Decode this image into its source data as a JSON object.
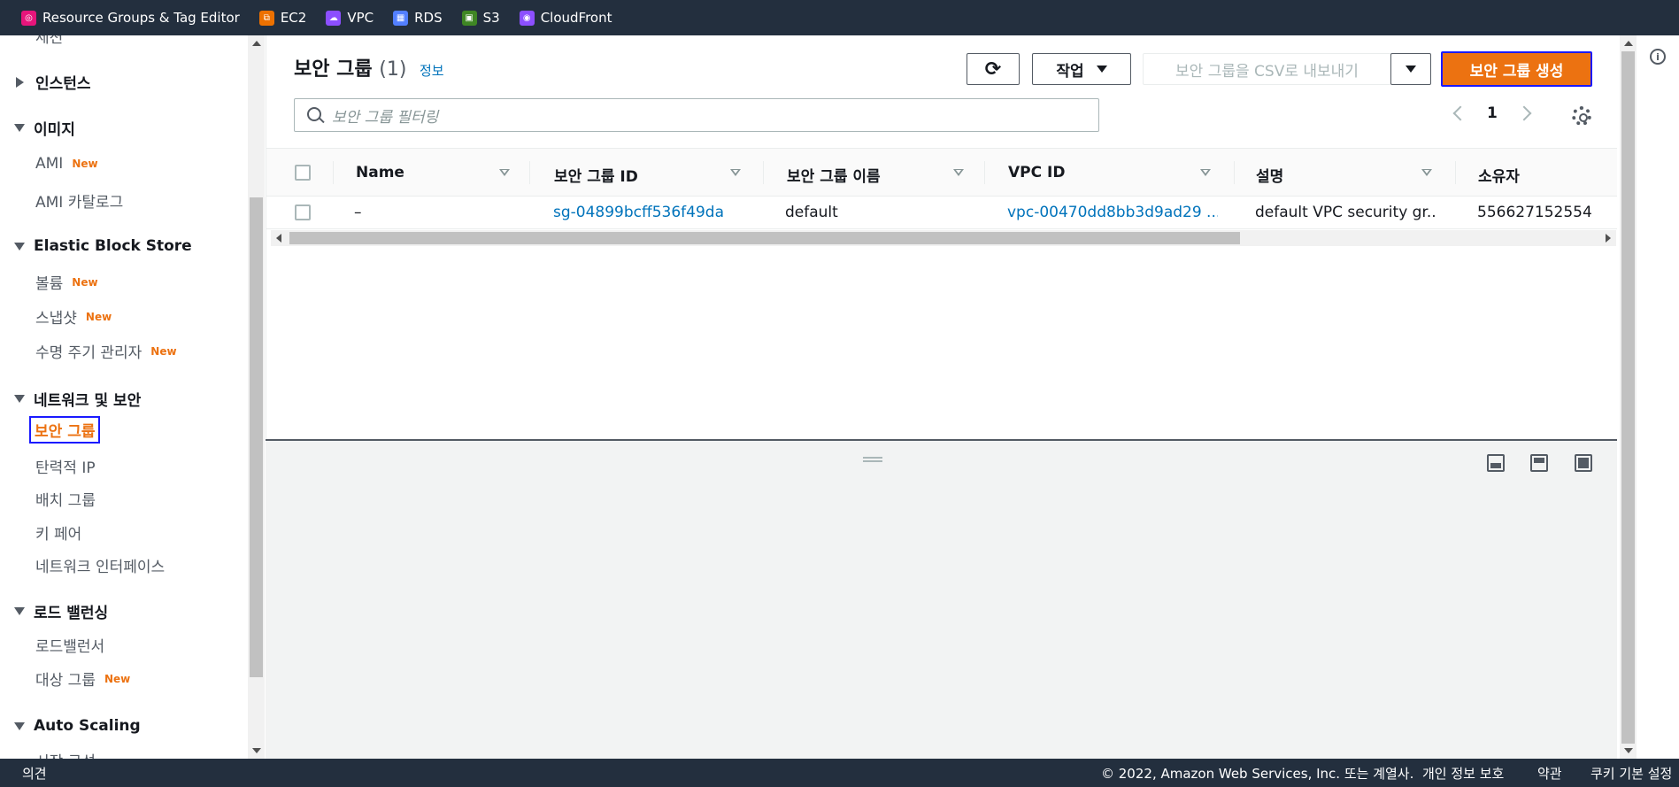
{
  "topbar": {
    "favorites": [
      {
        "label": "Resource Groups & Tag Editor",
        "icon": "resource-groups-icon",
        "color": "#e7157b"
      },
      {
        "label": "EC2",
        "icon": "ec2-icon",
        "color": "#ed7100"
      },
      {
        "label": "VPC",
        "icon": "vpc-icon",
        "color": "#8c4fff"
      },
      {
        "label": "RDS",
        "icon": "rds-icon",
        "color": "#527fff"
      },
      {
        "label": "S3",
        "icon": "s3-icon",
        "color": "#3f8624"
      },
      {
        "label": "CloudFront",
        "icon": "cloudfront-icon",
        "color": "#8c4fff"
      }
    ]
  },
  "sidebar": {
    "partial_top": "세션",
    "partial_bottom": "시작 구성",
    "instances": "인스턴스",
    "images": {
      "title": "이미지",
      "ami": "AMI",
      "ami_catalog": "AMI 카탈로그"
    },
    "ebs": {
      "title": "Elastic Block Store",
      "volumes": "볼륨",
      "snapshots": "스냅샷",
      "lifecycle": "수명 주기 관리자"
    },
    "network": {
      "title": "네트워크 및 보안",
      "security_groups": "보안 그룹",
      "elastic_ip": "탄력적 IP",
      "placement_groups": "배치 그룹",
      "key_pairs": "키 페어",
      "network_interfaces": "네트워크 인터페이스"
    },
    "load_balancing": {
      "title": "로드 밸런싱",
      "load_balancers": "로드밸런서",
      "target_groups": "대상 그룹"
    },
    "auto_scaling": {
      "title": "Auto Scaling"
    },
    "new_badge": "New"
  },
  "main": {
    "title": "보안 그룹",
    "count": "(1)",
    "info_link": "정보",
    "actions_label": "작업",
    "export_label": "보안 그룹을 CSV로 내보내기",
    "create_label": "보안 그룹 생성",
    "filter_placeholder": "보안 그룹 필터링",
    "page_number": "1",
    "columns": [
      "Name",
      "보안 그룹 ID",
      "보안 그룹 이름",
      "VPC ID",
      "설명",
      "소유자"
    ],
    "rows": [
      {
        "name": "–",
        "sg_id": "sg-04899bcff536f49da",
        "sg_name": "default",
        "vpc_id": "vpc-00470dd8bb3d9ad29 ...",
        "description": "default VPC security gr...",
        "owner": "556627152554"
      }
    ]
  },
  "footer": {
    "feedback": "의견",
    "copyright": "© 2022, Amazon Web Services, Inc. 또는 계열사.",
    "privacy": "개인 정보 보호",
    "terms": "약관",
    "cookies": "쿠키 기본 설정"
  }
}
